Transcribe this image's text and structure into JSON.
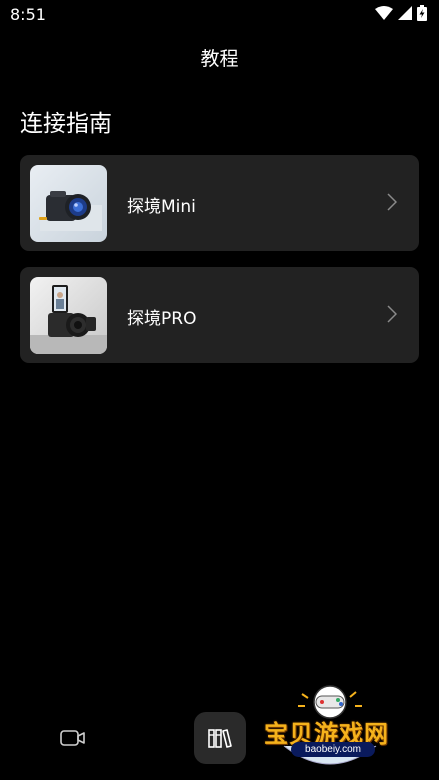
{
  "status_bar": {
    "time": "8:51",
    "icons": [
      "wifi-icon",
      "cellular-icon",
      "battery-charging-icon"
    ]
  },
  "header": {
    "title": "教程"
  },
  "section": {
    "title": "连接指南"
  },
  "cards": [
    {
      "label": "探境Mini",
      "thumb": "camera-mini-image"
    },
    {
      "label": "探境PRO",
      "thumb": "camera-pro-image"
    }
  ],
  "bottom_nav": [
    {
      "icon": "video-camera-icon",
      "active": false
    },
    {
      "icon": "library-icon",
      "active": true
    }
  ],
  "watermark": {
    "text": "宝贝游戏网",
    "url": "baobeiy.com"
  },
  "colors": {
    "background": "#000000",
    "card": "#222222",
    "text": "#ffffff",
    "chevron": "#8a8a8a"
  }
}
